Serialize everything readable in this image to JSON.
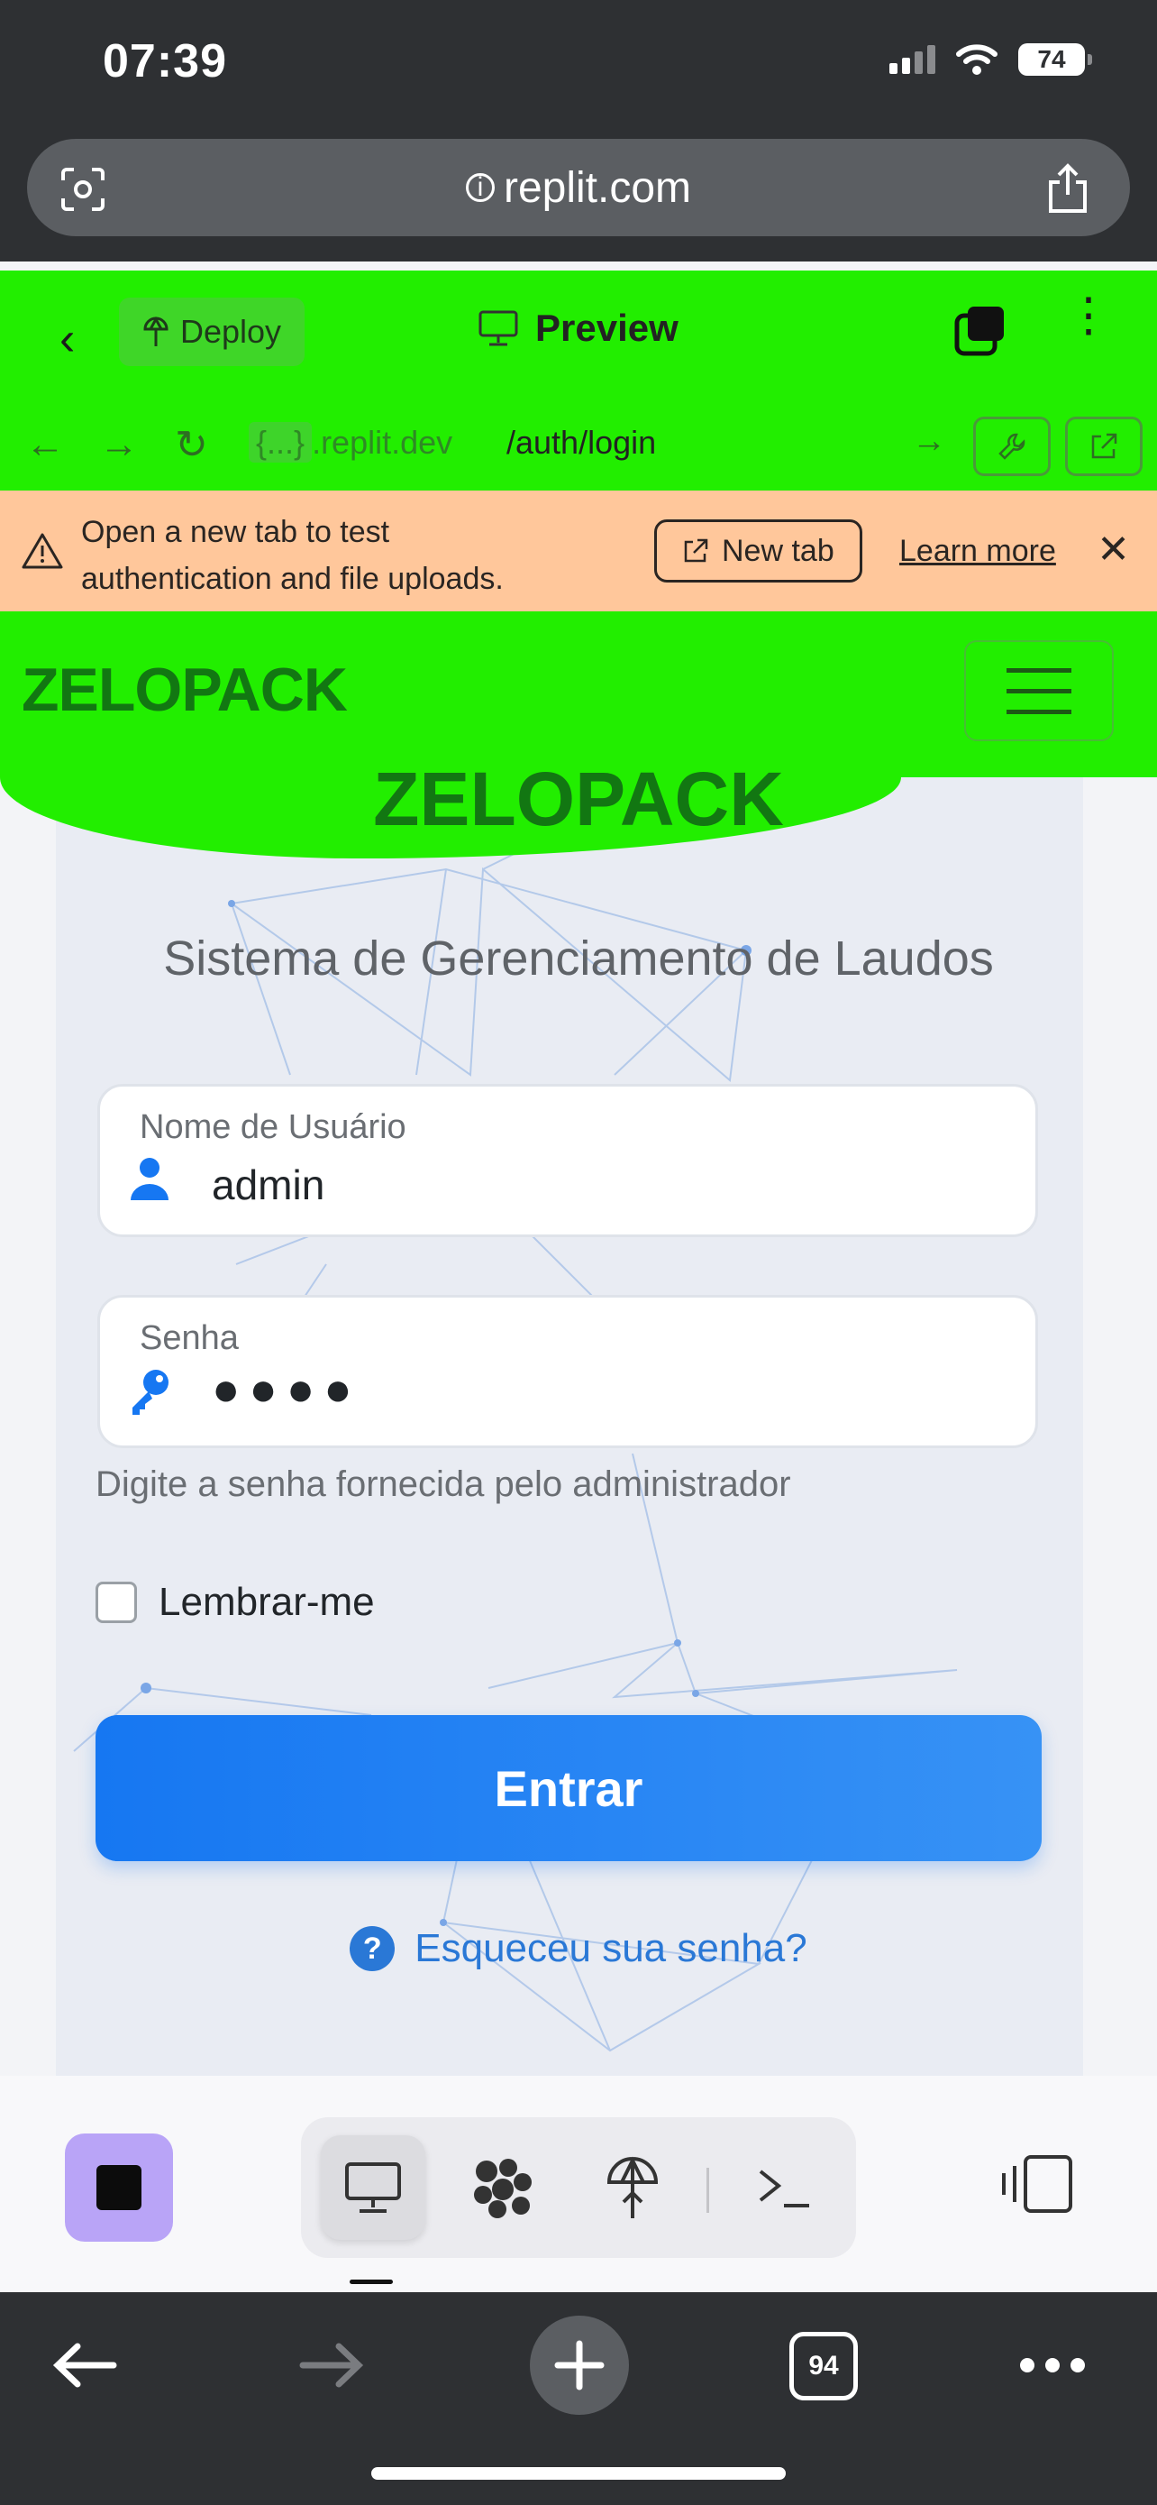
{
  "status_bar": {
    "time": "07:39",
    "battery": "74"
  },
  "browser": {
    "url": "replit.com",
    "tab_count": "94"
  },
  "replit_header": {
    "deploy_label": "Deploy",
    "preview_label": "Preview"
  },
  "replit_nav": {
    "dev_url_chip": "{...}",
    "dev_url_domain": ".replit.dev",
    "path": "/auth/login"
  },
  "banner": {
    "text": "Open a new tab to test authentication and file uploads.",
    "new_tab_label": "New tab",
    "learn_more_label": "Learn more"
  },
  "app": {
    "brand": "ZELOPACK",
    "card_brand": "ZELOPACK",
    "subtitle": "Sistema de Gerenciamento de Laudos",
    "username": {
      "label": "Nome de Usuário",
      "value": "admin"
    },
    "password": {
      "label": "Senha",
      "value": "●●●●"
    },
    "password_help": "Digite a senha fornecida pelo administrador",
    "remember_label": "Lembrar-me",
    "remember_checked": false,
    "submit_label": "Entrar",
    "forgot_label": "Esqueceu sua senha?"
  },
  "colors": {
    "highlighter": "#22ee00",
    "primary": "#1677f2",
    "brand": "#127712",
    "banner": "#ffc79b"
  }
}
